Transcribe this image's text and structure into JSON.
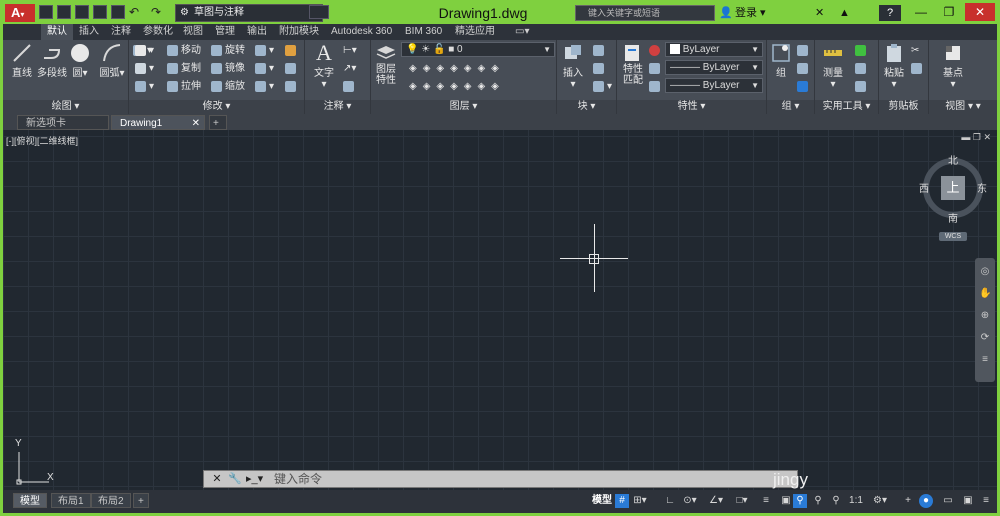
{
  "titlebar": {
    "app_letter": "A",
    "workspace": "草图与注释",
    "title": "Drawing1.dwg",
    "search_placeholder": "键入关键字或短语",
    "login": "登录",
    "help": "?"
  },
  "ribbon_tabs": [
    "默认",
    "插入",
    "注释",
    "参数化",
    "视图",
    "管理",
    "输出",
    "附加模块",
    "Autodesk 360",
    "BIM 360",
    "精选应用"
  ],
  "panels": {
    "draw": {
      "title": "绘图",
      "tools": [
        "直线",
        "多段线",
        "圆",
        "圆弧"
      ]
    },
    "modify": {
      "title": "修改",
      "tools": [
        "移动",
        "旋转",
        "复制",
        "镜像",
        "拉伸",
        "缩放"
      ]
    },
    "annotation": {
      "title": "注释",
      "tools": [
        "文字"
      ]
    },
    "layers": {
      "title": "图层",
      "tools": [
        "图层特性"
      ],
      "current_layer": "0"
    },
    "block": {
      "title": "块",
      "tools": [
        "插入"
      ]
    },
    "properties": {
      "title": "特性",
      "tools": [
        "特性匹配"
      ],
      "color": "ByLayer",
      "linetype": "ByLayer",
      "lineweight": "ByLayer"
    },
    "groups": {
      "title": "组",
      "tools": [
        "组"
      ]
    },
    "utilities": {
      "title": "实用工具",
      "tools": [
        "测量"
      ]
    },
    "clipboard": {
      "title": "剪贴板",
      "tools": [
        "粘贴"
      ]
    },
    "view": {
      "title": "视图",
      "tools": [
        "基点"
      ]
    }
  },
  "doc_tabs": [
    "新选项卡",
    "Drawing1"
  ],
  "viewport": {
    "label": "[-][俯视][二维线框]"
  },
  "viewcube": {
    "face": "上",
    "north": "北",
    "south": "南",
    "east": "东",
    "west": "西",
    "wcs": "WCS"
  },
  "ucs": {
    "x": "X",
    "y": "Y"
  },
  "command": {
    "placeholder": "键入命令"
  },
  "watermark": "jingy",
  "status": {
    "layout_tabs": [
      "模型",
      "布局1",
      "布局2"
    ],
    "add": "+",
    "model": "模型",
    "scale": "1:1"
  }
}
